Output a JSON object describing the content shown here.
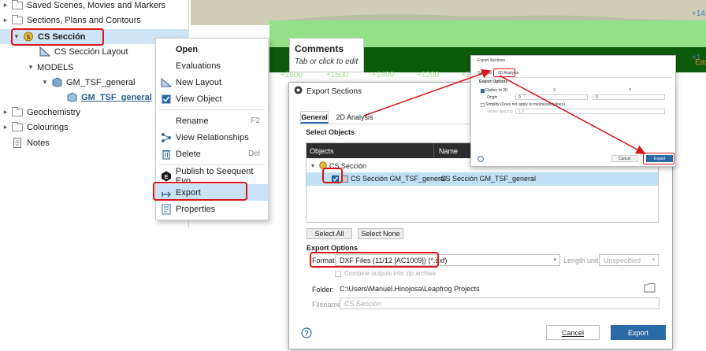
{
  "tree": {
    "items": [
      {
        "label": "Saved Scenes, Movies and Markers"
      },
      {
        "label": "Sections, Plans and Contours"
      },
      {
        "label": "CS Sección"
      },
      {
        "label": "CS Sección Layout"
      },
      {
        "label": "MODELS"
      },
      {
        "label": "GM_TSF_general"
      },
      {
        "label": "GM_TSF_general"
      },
      {
        "label": "Geochemistry"
      },
      {
        "label": "Colourings"
      },
      {
        "label": "Notes"
      }
    ]
  },
  "scene": {
    "axis_labels": [
      "+1600",
      "+1500",
      "+1400",
      "+1200",
      "+1"
    ],
    "right_labels": [
      "+14",
      "+1",
      "Eas"
    ],
    "colors": {
      "sky": "#cfcdb5",
      "terrain_light": "#93e186",
      "terrain_dark": "#0c5a0c",
      "axis_text": "#a2e08e"
    }
  },
  "context_menu": {
    "items": [
      {
        "label": "Open",
        "shortcut": "",
        "icon": "none"
      },
      {
        "label": "Evaluations",
        "shortcut": "",
        "icon": "none"
      },
      {
        "label": "New Layout",
        "shortcut": "",
        "icon": "layout-icon"
      },
      {
        "label": "View Object",
        "shortcut": "",
        "icon": "checkbox-checked-icon"
      },
      {
        "label": "Rename",
        "shortcut": "F2",
        "icon": "none"
      },
      {
        "label": "View Relationships",
        "shortcut": "",
        "icon": "relationships-icon"
      },
      {
        "label": "Delete",
        "shortcut": "Del",
        "icon": "trash-icon"
      },
      {
        "label": "Publish to Seequent Evo",
        "shortcut": "",
        "icon": "evo-icon"
      },
      {
        "label": "Export",
        "shortcut": "",
        "icon": "export-icon"
      },
      {
        "label": "Properties",
        "shortcut": "",
        "icon": "properties-icon"
      }
    ]
  },
  "comments": {
    "title": "Comments",
    "subtitle": "Tab or click to edit"
  },
  "export_dialog": {
    "title": "Export Sections",
    "tabs": [
      "General",
      "2D Analysis"
    ],
    "select_objects_label": "Select Objects",
    "columns": [
      "Objects",
      "Name"
    ],
    "group_label": "CS Sección",
    "row": {
      "object": "CS Sección GM_TSF_general",
      "name": "CS Sección GM_TSF_general",
      "checked": true
    },
    "select_all_label": "Select All",
    "select_none_label": "Select None",
    "export_options_label": "Export Options",
    "format_label": "Format:",
    "format_value": "DXF Files (11/12 [AC1009]) (*.dxf)",
    "length_unit_label": "Length unit:",
    "length_unit_value": "Unspecified",
    "combine_label": "Combine outputs into zip archive",
    "folder_label": "Folder:",
    "folder_value": "C:\\Users\\Manuel.Hinojosa\\Leapfrog Projects",
    "filename_label": "Filename:",
    "filename_placeholder": "CS Sección",
    "cancel_label": "Cancel",
    "export_label": "Export",
    "accent": "#2c6aa6",
    "highlight": "#bfe0f5"
  },
  "mini_dialog": {
    "title": "Export Sections",
    "tabs": [
      "General",
      "2D Analysis"
    ],
    "export_options_label": "Export Options",
    "flatten_label": "Flatten to 2D",
    "origin_label": "Origin",
    "col_x": "X",
    "col_y": "Y",
    "origin_x": "0",
    "origin_y": "0",
    "simplify_label": "Simplify (Does not apply to meshes/polylines)",
    "vertex_spacing_label": "Vertex spacing",
    "vertex_spacing_value": "1.0",
    "cancel_label": "Cancel",
    "export_label": "Export"
  },
  "annotation_color": "#d9141b"
}
